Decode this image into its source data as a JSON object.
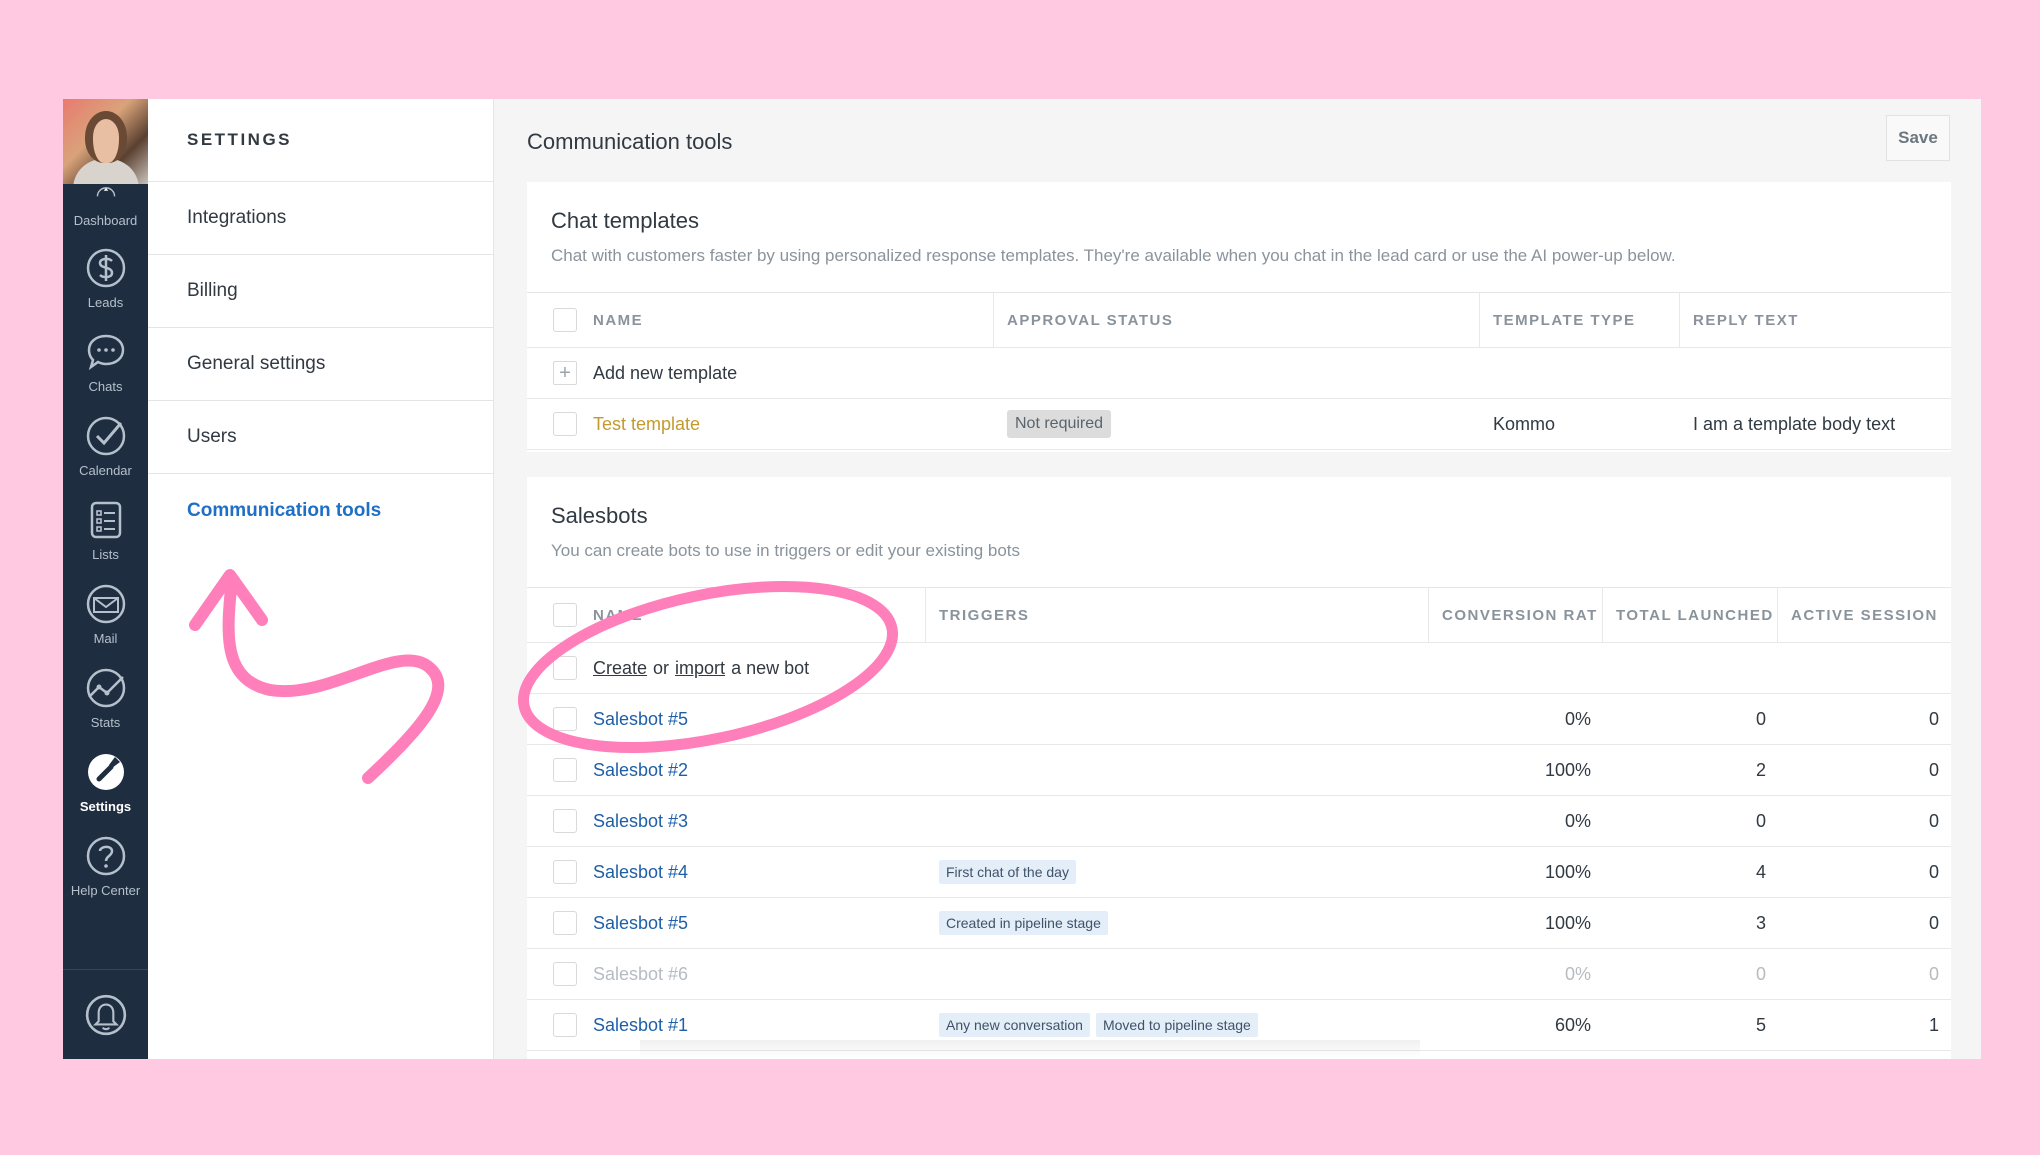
{
  "nav": {
    "items": [
      {
        "label": "Dashboard",
        "icon": "dashboard-icon"
      },
      {
        "label": "Leads",
        "icon": "dollar-icon"
      },
      {
        "label": "Chats",
        "icon": "chat-bubble-icon"
      },
      {
        "label": "Calendar",
        "icon": "checkmark-icon"
      },
      {
        "label": "Lists",
        "icon": "list-icon"
      },
      {
        "label": "Mail",
        "icon": "mail-icon"
      },
      {
        "label": "Stats",
        "icon": "stats-icon"
      },
      {
        "label": "Settings",
        "icon": "wrench-icon"
      },
      {
        "label": "Help Center",
        "icon": "help-icon"
      }
    ],
    "bottom_icon": "bell-icon"
  },
  "sidebar": {
    "title": "SETTINGS",
    "items": [
      {
        "label": "Integrations"
      },
      {
        "label": "Billing"
      },
      {
        "label": "General settings"
      },
      {
        "label": "Users"
      },
      {
        "label": "Communication tools"
      }
    ]
  },
  "main": {
    "title": "Communication tools",
    "save_label": "Save"
  },
  "chat_templates": {
    "title": "Chat templates",
    "subtitle": "Chat with customers faster by using personalized response templates. They're available when you chat in the lead card or use the AI power-up below.",
    "columns": [
      "NAME",
      "APPROVAL STATUS",
      "TEMPLATE TYPE",
      "REPLY TEXT"
    ],
    "add_label": "Add new template",
    "rows": [
      {
        "name": "Test template",
        "status": "Not required",
        "type": "Kommo",
        "reply": "I am a template body text"
      }
    ]
  },
  "salesbots": {
    "title": "Salesbots",
    "subtitle": "You can create bots to use in triggers or edit your existing bots",
    "columns": [
      "NAME",
      "TRIGGERS",
      "CONVERSION RAT",
      "TOTAL LAUNCHED",
      "ACTIVE SESSION"
    ],
    "create_link": "Create",
    "create_or": "or",
    "import_link": "import",
    "create_rest": "a new bot",
    "rows": [
      {
        "name": "Salesbot #5",
        "triggers": [],
        "conversion": "0%",
        "launched": "0",
        "active": "0"
      },
      {
        "name": "Salesbot #2",
        "triggers": [],
        "conversion": "100%",
        "launched": "2",
        "active": "0"
      },
      {
        "name": "Salesbot #3",
        "triggers": [],
        "conversion": "0%",
        "launched": "0",
        "active": "0"
      },
      {
        "name": "Salesbot #4",
        "triggers": [
          "First chat of the day"
        ],
        "conversion": "100%",
        "launched": "4",
        "active": "0"
      },
      {
        "name": "Salesbot #5",
        "triggers": [
          "Created in pipeline stage"
        ],
        "conversion": "100%",
        "launched": "3",
        "active": "0"
      },
      {
        "name": "Salesbot #6",
        "triggers": [],
        "conversion": "0%",
        "launched": "0",
        "active": "0",
        "disabled": true
      },
      {
        "name": "Salesbot #1",
        "triggers": [
          "Any new conversation",
          "Moved to pipeline stage"
        ],
        "conversion": "60%",
        "launched": "5",
        "active": "1"
      }
    ]
  },
  "colors": {
    "background": "#ffc9e1",
    "nav": "#1e2d3f",
    "accent_blue": "#1f6fc6",
    "annotation_pink": "#ff7fba"
  }
}
